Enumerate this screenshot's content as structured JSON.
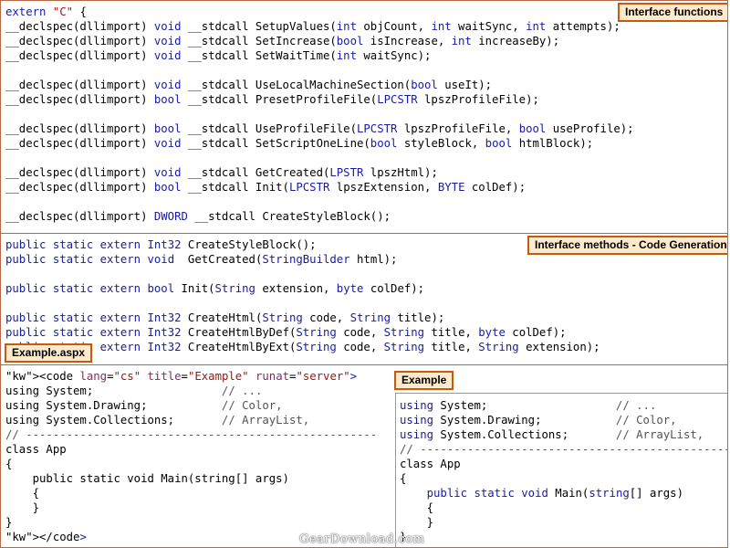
{
  "panels": {
    "interface_functions": {
      "badge": "Interface functions",
      "lines": [
        "extern \"C\" {",
        "__declspec(dllimport) void __stdcall SetupValues(int objCount, int waitSync, int attempts);",
        "__declspec(dllimport) void __stdcall SetIncrease(bool isIncrease, int increaseBy);",
        "__declspec(dllimport) void __stdcall SetWaitTime(int waitSync);",
        "",
        "__declspec(dllimport) void __stdcall UseLocalMachineSection(bool useIt);",
        "__declspec(dllimport) bool __stdcall PresetProfileFile(LPCSTR lpszProfileFile);",
        "",
        "__declspec(dllimport) bool __stdcall UseProfileFile(LPCSTR lpszProfileFile, bool useProfile);",
        "__declspec(dllimport) void __stdcall SetScriptOneLine(bool styleBlock, bool htmlBlock);",
        "",
        "__declspec(dllimport) void __stdcall GetCreated(LPSTR lpszHtml);",
        "__declspec(dllimport) bool __stdcall Init(LPCSTR lpszExtension, BYTE colDef);",
        "",
        "__declspec(dllimport) DWORD __stdcall CreateStyleBlock();"
      ]
    },
    "interface_methods": {
      "badge": "Interface methods - Code Generation",
      "lines": [
        "public static extern Int32 CreateStyleBlock();",
        "public static extern void  GetCreated(StringBuilder html);",
        "",
        "public static extern bool Init(String extension, byte colDef);",
        "",
        "public static extern Int32 CreateHtml(String code, String title);",
        "public static extern Int32 CreateHtmlByDef(String code, String title, byte colDef);",
        "public static extern Int32 CreateHtmlByExt(String code, String title, String extension);"
      ]
    },
    "example_aspx": {
      "badge": "Example.aspx",
      "lines": [
        "<code lang=\"cs\" title=\"Example\" runat=\"server\">",
        "using System;                   // ...",
        "using System.Drawing;           // Color,",
        "using System.Collections;       // ArrayList,",
        "// ----------------------------------------------------",
        "class App",
        "{",
        "    public static void Main(string[] args)",
        "    {",
        "    }",
        "}",
        "</code>"
      ]
    },
    "example": {
      "badge": "Example",
      "lines": [
        "using System;                   // ...",
        "using System.Drawing;           // Color,",
        "using System.Collections;       // ArrayList,",
        "// ----------------------------------------------------",
        "class App",
        "{",
        "    public static void Main(string[] args)",
        "    {",
        "    }",
        "}"
      ]
    }
  },
  "watermark": "GearDownload.com"
}
